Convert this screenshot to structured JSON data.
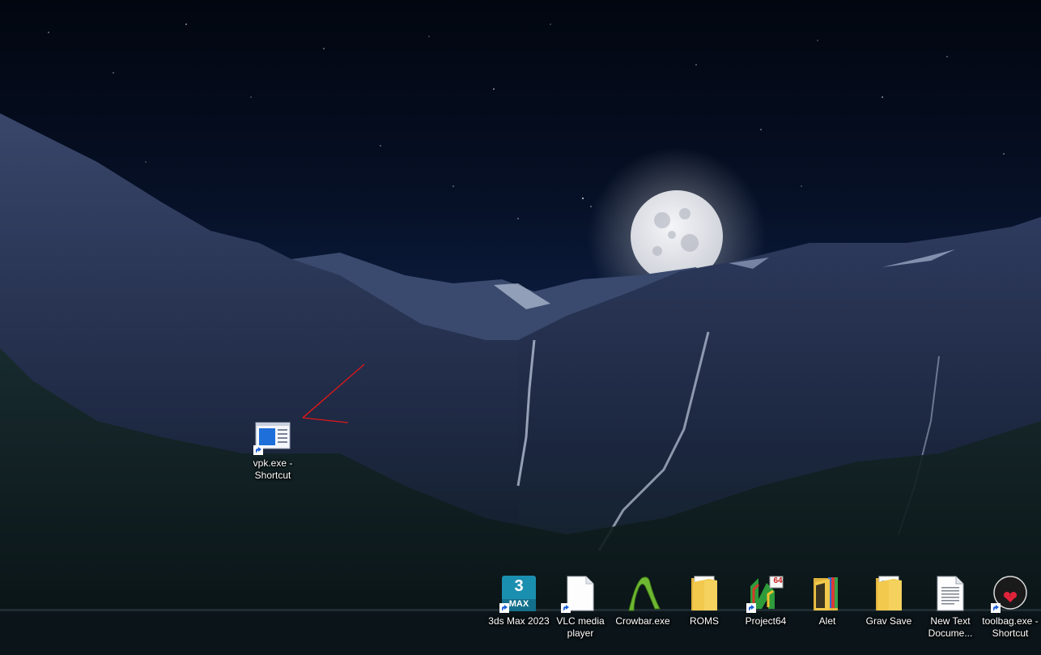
{
  "desktop": {
    "icons": [
      {
        "label": "vpk.exe - Shortcut",
        "icon": "vpk-window-icon"
      },
      {
        "label": "3ds Max 2023",
        "icon": "3ds-max-icon",
        "badge_number": "3",
        "badge_text": "MAX"
      },
      {
        "label": "VLC media player",
        "icon": "blank-document-icon"
      },
      {
        "label": "Crowbar.exe",
        "icon": "crowbar-icon"
      },
      {
        "label": "ROMS",
        "icon": "folder-icon"
      },
      {
        "label": "Project64",
        "icon": "project64-icon",
        "badge_text": "64"
      },
      {
        "label": "Alet",
        "icon": "folder-icon"
      },
      {
        "label": "Grav Save",
        "icon": "folder-icon"
      },
      {
        "label": "New Text Docume...",
        "icon": "text-document-icon"
      },
      {
        "label": "toolbag.exe - Shortcut",
        "icon": "toolbag-icon"
      }
    ],
    "annotation": "red-arrow-annotation",
    "colors": {
      "moon": "#e9eaee",
      "sky": "#061026",
      "annotation": "#e01818",
      "folder": "#f2c94c",
      "max_badge": "#1b8fb0"
    }
  }
}
